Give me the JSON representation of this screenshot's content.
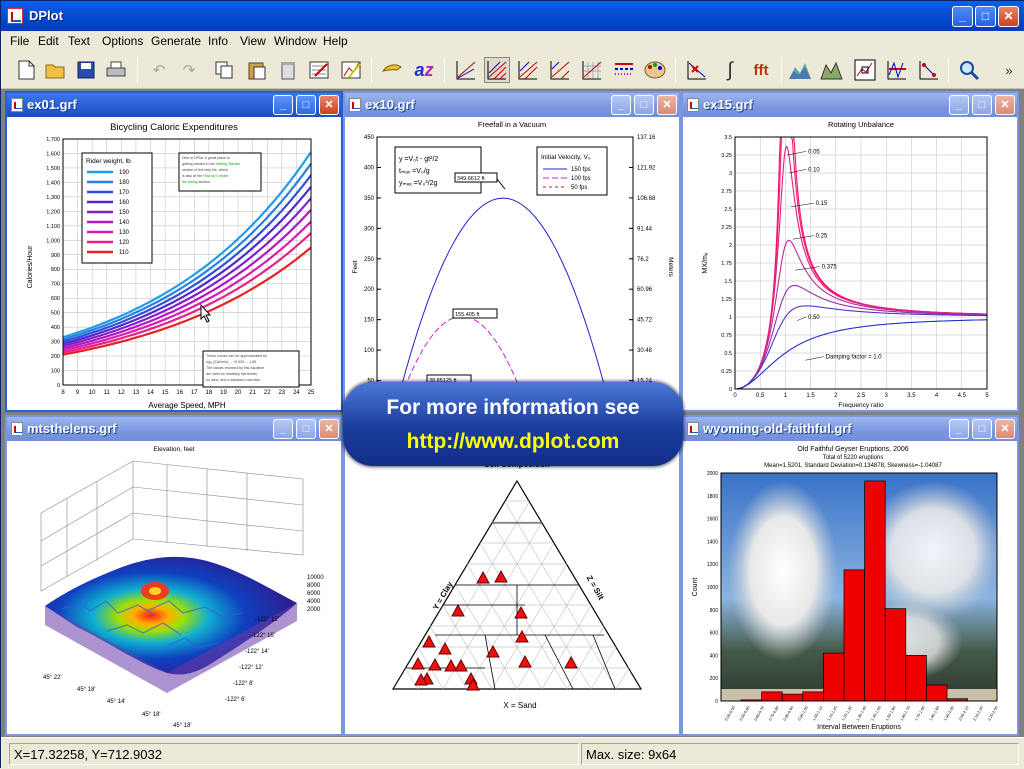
{
  "app": {
    "title": "DPlot"
  },
  "menu": [
    "File",
    "Edit",
    "Text",
    "Options",
    "Generate",
    "Info",
    "View",
    "Window",
    "Help"
  ],
  "toolbar_icons": [
    "new-icon",
    "open-icon",
    "save-icon",
    "print-icon",
    "undo-icon",
    "redo-icon",
    "copy-icon",
    "paste-icon",
    "delete-icon",
    "edit-data-icon",
    "edit-curve-icon",
    "hand-icon",
    "az-text-icon",
    "axes-linear-icon",
    "axes-loglin-icon",
    "axes-linlog-icon",
    "axes-loglog-icon",
    "axes-grid-icon",
    "line-styles-icon",
    "palette-icon",
    "remove-point-icon",
    "integrate-icon",
    "fft-icon",
    "contour-icon",
    "surface-icon",
    "zoom-box-icon",
    "plot-settings-icon",
    "scale-icon",
    "zoom-icon",
    "overflow-icon"
  ],
  "windows": {
    "ex01": {
      "title": "ex01.grf",
      "chart_title": "Bicycling Caloric Expenditures",
      "xlabel": "Average Speed, MPH",
      "ylabel": "Calories/Hour",
      "legend_title": "Rider weight, lb",
      "note1": "New in DPlot Version 2: Legend is placed... see Getting Started section of the help file... also available ... How do I create the dialog...",
      "note2": "These curves can be approximated by log(Cal/min) ... The values returned by this equation are valid for relatively flat terrain, no wind, and a standard road bike with normal ergonomic equipment."
    },
    "ex10": {
      "title": "ex10.grf",
      "chart_title": "Freefall in a Vacuum",
      "ylabel_left": "Feet",
      "ylabel_right": "Meters",
      "eq1": "y    =V₀t - gt²/2",
      "eq2": "tₘₐₓ  =V₀/g",
      "eq3": "yₘₐₓ =V₀²/2g",
      "legend_title": "Initial Velocity, V₀",
      "ann1": "349.6612 ft",
      "ann2": "155.405 ft",
      "ann3": "38.85125 ft"
    },
    "ex15": {
      "title": "ex15.grf",
      "chart_title": "Rotating Unbalance",
      "xlabel": "Frequency ratio",
      "ylabel": "MX/mₑ",
      "damping_label": "Damping factor = 1.0"
    },
    "mtsthelens": {
      "title": "mtsthelens.grf",
      "chart_title": "Elevation, feet"
    },
    "soil": {
      "title": "Soil Composition",
      "xlabel": "X = Sand",
      "ylabel": "Y = Clay",
      "zlabel": "Z = Silt"
    },
    "wyoming": {
      "title": "wyoming-old-faithful.grf",
      "chart_title": "Old Faithful Geyser Eruptions, 2006",
      "sub1": "Total of 5220 eruptions",
      "sub2": "Mean=1.5201, Standard Deviation=0.134878, Skewness=-1.04087",
      "xlabel": "Interval Between Eruptions",
      "ylabel": "Count"
    }
  },
  "banner": {
    "line1": "For more information see",
    "line2": "http://www.dplot.com"
  },
  "status": {
    "coords": "X=17.32258, Y=712.9032",
    "size": "Max. size: 9x64"
  },
  "chart_data": [
    {
      "id": "ex01",
      "type": "line",
      "title": "Bicycling Caloric Expenditures",
      "xlabel": "Average Speed, MPH",
      "ylabel": "Calories/Hour",
      "xlim": [
        8,
        25
      ],
      "ylim": [
        0,
        1700
      ],
      "x_ticks": [
        8,
        9,
        10,
        11,
        12,
        13,
        14,
        15,
        16,
        17,
        18,
        19,
        20,
        21,
        22,
        23,
        24,
        25
      ],
      "y_ticks": [
        0,
        100,
        200,
        300,
        400,
        500,
        600,
        700,
        800,
        900,
        1000,
        1100,
        1200,
        1300,
        1400,
        1500,
        1600,
        1700
      ],
      "y_tick_labels": [
        "0",
        "100",
        "200",
        "300",
        "400",
        "500",
        "600",
        "700",
        "800",
        "900",
        "1,000",
        "1,100",
        "1,200",
        "1,300",
        "1,400",
        "1,500",
        "1,600",
        "1,700"
      ],
      "legend_title": "Rider weight, lb",
      "series": [
        {
          "name": "190",
          "color": "#1e9ee8",
          "y8": 330,
          "y25": 1610
        },
        {
          "name": "180",
          "color": "#2a7fe0",
          "y8": 315,
          "y25": 1530
        },
        {
          "name": "170",
          "color": "#3050d8",
          "y8": 300,
          "y25": 1450
        },
        {
          "name": "160",
          "color": "#5028d0",
          "y8": 285,
          "y25": 1370
        },
        {
          "name": "150",
          "color": "#8020c8",
          "y8": 270,
          "y25": 1290
        },
        {
          "name": "140",
          "color": "#b018c0",
          "y8": 255,
          "y25": 1210
        },
        {
          "name": "130",
          "color": "#d81cb0",
          "y8": 240,
          "y25": 1130
        },
        {
          "name": "120",
          "color": "#e8208a",
          "y8": 225,
          "y25": 1050
        },
        {
          "name": "110",
          "color": "#e82020",
          "y8": 210,
          "y25": 950
        }
      ]
    },
    {
      "id": "ex10",
      "type": "line",
      "title": "Freefall in a Vacuum",
      "ylabel": "Feet",
      "ylim": [
        0,
        450
      ],
      "y_ticks": [
        50,
        100,
        150,
        200,
        250,
        300,
        350,
        400,
        450
      ],
      "y2_tick_labels": [
        "15.24",
        "30.48",
        "45.72",
        "60.96",
        "76.2",
        "91.44",
        "106.68",
        "121.92",
        "137.16"
      ],
      "series": [
        {
          "name": "150 fps",
          "peak": 349.6612,
          "color": "#2020d0"
        },
        {
          "name": "100 fps",
          "peak": 155.405,
          "color": "#d020d0"
        },
        {
          "name": "50 fps",
          "peak": 38.85125,
          "color": "#d02020"
        }
      ]
    },
    {
      "id": "ex15",
      "type": "line",
      "title": "Rotating Unbalance",
      "xlabel": "Frequency ratio",
      "xlim": [
        0,
        5
      ],
      "ylim": [
        0,
        3.5
      ],
      "x_ticks": [
        "0",
        "0.5",
        "1",
        "1.5",
        "2",
        "2.5",
        "3",
        "3.5",
        "4",
        "4.5",
        "5"
      ],
      "y_ticks": [
        "0",
        "0.25",
        "0.5",
        "0.75",
        "1",
        "1.25",
        "1.5",
        "1.75",
        "2",
        "2.25",
        "2.5",
        "2.75",
        "3",
        "3.25",
        "3.5"
      ],
      "damping": [
        "0.05",
        "0.10",
        "0.15",
        "0.25",
        "0.375",
        "0.50",
        "Damping factor = 1.0"
      ]
    },
    {
      "id": "wyoming",
      "type": "bar",
      "title": "Old Faithful Geyser Eruptions, 2006",
      "xlabel": "Interval Between Eruptions",
      "ylabel": "Count",
      "ylim": [
        0,
        2000
      ],
      "y_ticks": [
        0,
        200,
        400,
        600,
        800,
        1000,
        1200,
        1400,
        1600,
        1800,
        2000
      ],
      "values": [
        10,
        80,
        60,
        80,
        420,
        1150,
        1930,
        810,
        400,
        140,
        20
      ]
    }
  ]
}
